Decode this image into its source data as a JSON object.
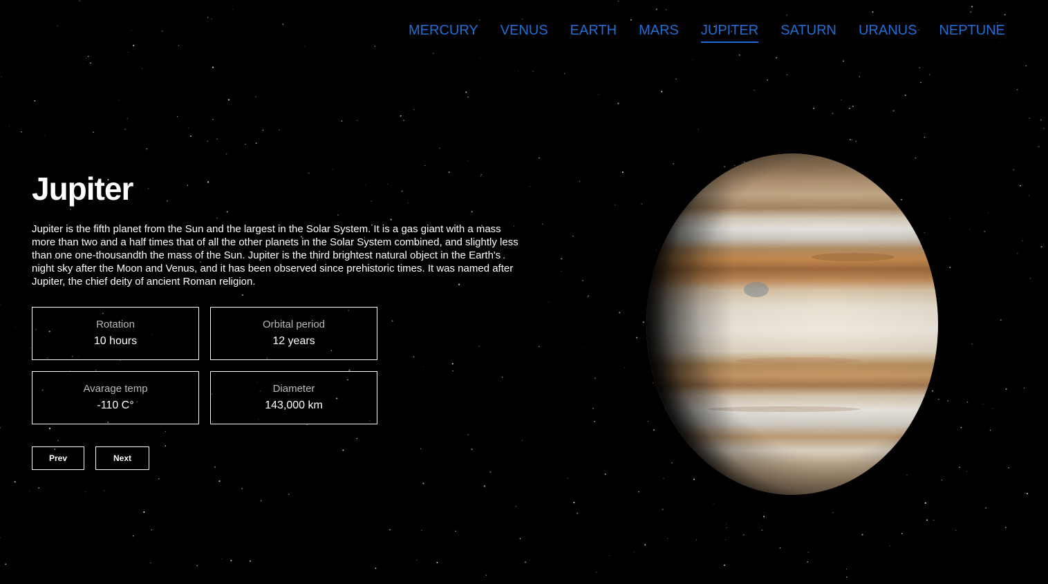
{
  "nav": {
    "items": [
      {
        "label": "MERCURY",
        "active": false
      },
      {
        "label": "VENUS",
        "active": false
      },
      {
        "label": "EARTH",
        "active": false
      },
      {
        "label": "MARS",
        "active": false
      },
      {
        "label": "JUPITER",
        "active": true
      },
      {
        "label": "SATURN",
        "active": false
      },
      {
        "label": "URANUS",
        "active": false
      },
      {
        "label": "NEPTUNE",
        "active": false
      }
    ]
  },
  "planet": {
    "name": "Jupiter",
    "description": "Jupiter is the fifth planet from the Sun and the largest in the Solar System. It is a gas giant with a mass more than two and a half times that of all the other planets in the Solar System combined, and slightly less than one one-thousandth the mass of the Sun. Jupiter is the third brightest natural object in the Earth's night sky after the Moon and Venus, and it has been observed since prehistoric times. It was named after Jupiter, the chief deity of ancient Roman religion.",
    "stats": [
      {
        "label": "Rotation",
        "value": "10 hours"
      },
      {
        "label": "Orbital period",
        "value": "12 years"
      },
      {
        "label": "Avarage temp",
        "value": "-110 C°"
      },
      {
        "label": "Diameter",
        "value": "143,000 km"
      }
    ]
  },
  "buttons": {
    "prev_label": "Prev",
    "next_label": "Next"
  },
  "colors": {
    "background": "#000000",
    "nav_accent": "#1f6fd6",
    "text": "#ffffff",
    "stat_label": "#b9b9b9"
  }
}
